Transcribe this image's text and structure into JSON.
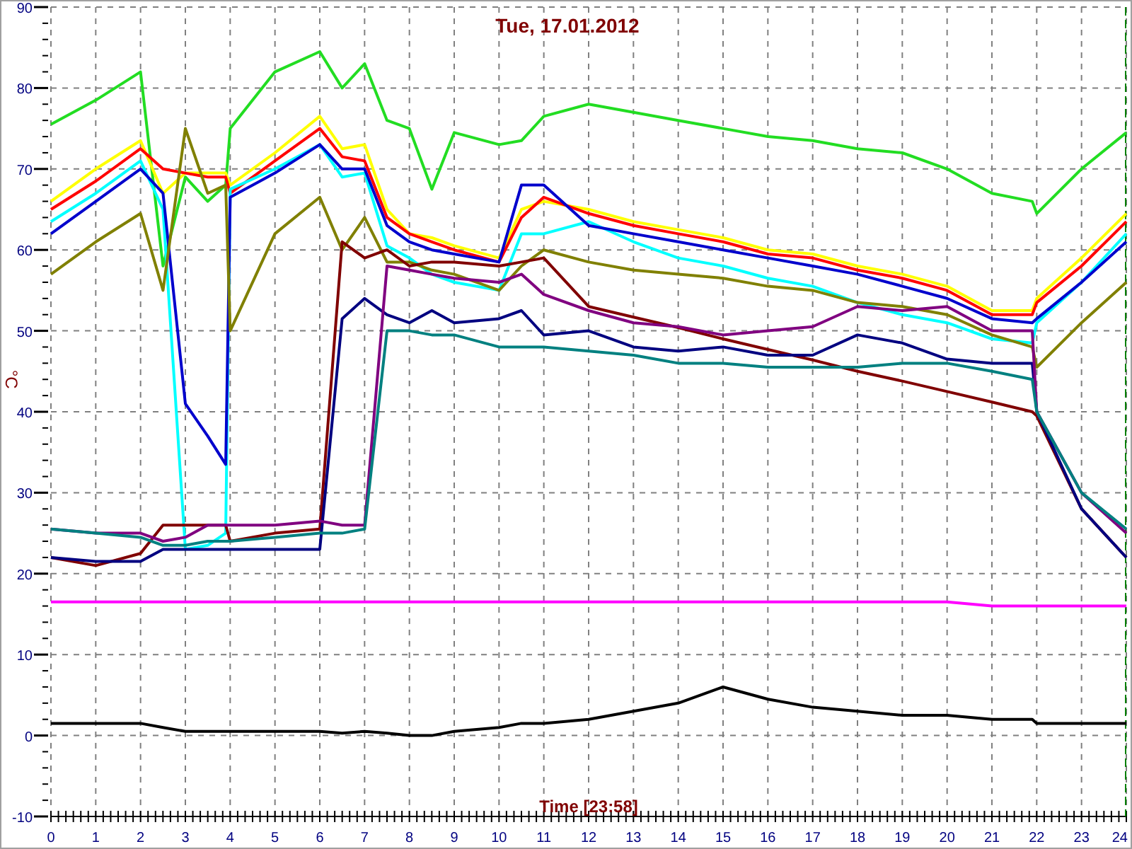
{
  "chart": {
    "chart_data": {
      "type": "line",
      "title": "Tue, 17.01.2012",
      "xlabel": "Time [23:58]",
      "ylabel": "°C",
      "x": [
        0,
        1,
        2,
        2.5,
        3,
        3.5,
        3.9,
        4,
        5,
        6,
        6.5,
        7,
        7.5,
        8,
        8.5,
        9,
        10,
        10.5,
        11,
        12,
        13,
        14,
        15,
        16,
        17,
        18,
        19,
        20,
        21,
        21.9,
        22,
        23,
        24
      ],
      "series": [
        {
          "color": "#22dd22",
          "values": [
            75.5,
            78.5,
            82,
            58,
            69,
            66,
            68,
            75,
            82,
            84.5,
            80,
            83,
            76,
            75,
            67.5,
            74.5,
            73,
            73.5,
            76.5,
            78,
            77,
            76,
            75,
            74,
            73.5,
            72.5,
            72,
            70,
            67,
            66,
            64.5,
            70,
            74.5
          ]
        },
        {
          "color": "#ffff00",
          "values": [
            66,
            70,
            73.5,
            67,
            69.5,
            69.5,
            69.5,
            68,
            72,
            76.5,
            72.5,
            73,
            65,
            62,
            61.5,
            60.5,
            59,
            65,
            66,
            65,
            63.5,
            62.5,
            61.5,
            60,
            59.5,
            58,
            57,
            55.5,
            52.5,
            52.5,
            54,
            59,
            64.5
          ]
        },
        {
          "color": "#ff0000",
          "values": [
            65,
            68.5,
            72.5,
            70,
            69.5,
            69,
            69,
            67,
            71,
            75,
            71.5,
            71,
            64,
            62,
            61,
            60,
            58.5,
            64,
            66.5,
            64.5,
            63,
            62,
            61,
            59.5,
            59,
            57.5,
            56.5,
            55,
            52,
            52,
            53.5,
            58,
            63.5
          ]
        },
        {
          "color": "#00ffff",
          "values": [
            63.5,
            67,
            71,
            65,
            23,
            23.5,
            25,
            67.5,
            70,
            73,
            69,
            69.5,
            60.5,
            59,
            57,
            56,
            55,
            62,
            62,
            63.5,
            61,
            59,
            58,
            56.5,
            55.5,
            53.5,
            52,
            51,
            49,
            48.5,
            51,
            56,
            62
          ]
        },
        {
          "color": "#0000cc",
          "values": [
            62,
            66,
            70,
            67,
            41,
            37,
            33.5,
            66.5,
            69.5,
            73,
            70,
            70,
            63,
            61,
            60,
            59.5,
            58.5,
            68,
            68,
            63,
            62,
            61,
            60,
            59,
            58,
            57,
            55.5,
            54,
            51.5,
            51,
            51.5,
            56,
            61
          ]
        },
        {
          "color": "#808000",
          "values": [
            57,
            61,
            64.5,
            55,
            75,
            67,
            68,
            50,
            62,
            66.5,
            60,
            64,
            58.5,
            58.5,
            57.5,
            57,
            55,
            58,
            60,
            58.5,
            57.5,
            57,
            56.5,
            55.5,
            55,
            53.5,
            53,
            52,
            49.5,
            48,
            45.5,
            51,
            56
          ]
        },
        {
          "color": "#800000",
          "values": [
            22,
            21,
            22.5,
            26,
            26,
            26,
            26,
            24,
            25,
            25.5,
            61,
            59,
            60,
            58,
            58.5,
            58.5,
            58,
            58.5,
            59,
            53,
            51.7,
            50.4,
            49,
            47.7,
            46.4,
            45,
            43.8,
            42.5,
            41.2,
            40,
            39.5,
            28,
            22
          ]
        },
        {
          "color": "#000080",
          "values": [
            22,
            21.5,
            21.5,
            23,
            23,
            23,
            23,
            23,
            23,
            23,
            51.5,
            54,
            52,
            51,
            52.5,
            51,
            51.5,
            52.5,
            49.5,
            50,
            48,
            47.5,
            48,
            47,
            47,
            49.5,
            48.5,
            46.5,
            46,
            46,
            40,
            28,
            22
          ]
        },
        {
          "color": "#800080",
          "values": [
            25.5,
            25,
            25,
            24,
            24.5,
            26,
            26,
            26,
            26,
            26.5,
            26,
            26,
            58,
            57.5,
            57,
            56.5,
            56,
            57,
            54.5,
            52.5,
            51,
            50.5,
            49.5,
            50,
            50.5,
            53,
            52.5,
            53,
            50,
            50,
            40,
            30,
            25
          ]
        },
        {
          "color": "#008080",
          "values": [
            25.5,
            25,
            24.5,
            23.5,
            23.5,
            24,
            24,
            24,
            24.5,
            25,
            25,
            25.5,
            50,
            50,
            49.5,
            49.5,
            48,
            48,
            48,
            47.5,
            47,
            46,
            46,
            45.5,
            45.5,
            45.5,
            46,
            46,
            45,
            44,
            40,
            30,
            25.5
          ]
        },
        {
          "color": "#ff00ff",
          "values": [
            16.5,
            16.5,
            16.5,
            16.5,
            16.5,
            16.5,
            16.5,
            16.5,
            16.5,
            16.5,
            16.5,
            16.5,
            16.5,
            16.5,
            16.5,
            16.5,
            16.5,
            16.5,
            16.5,
            16.5,
            16.5,
            16.5,
            16.5,
            16.5,
            16.5,
            16.5,
            16.5,
            16.5,
            16,
            16,
            16,
            16,
            16
          ]
        },
        {
          "color": "#000000",
          "values": [
            1.5,
            1.5,
            1.5,
            1,
            0.5,
            0.5,
            0.5,
            0.5,
            0.5,
            0.5,
            0.3,
            0.5,
            0.3,
            0,
            0,
            0.5,
            1,
            1.5,
            1.5,
            2,
            3,
            4,
            6,
            4.5,
            3.5,
            3,
            2.5,
            2.5,
            2,
            2,
            1.5,
            1.5,
            1.5
          ]
        }
      ],
      "grid": true,
      "xlim": [
        0,
        24
      ],
      "ylim": [
        -10,
        90
      ],
      "xticks": [
        0,
        1,
        2,
        3,
        4,
        5,
        6,
        7,
        8,
        9,
        10,
        11,
        12,
        13,
        14,
        15,
        16,
        17,
        18,
        19,
        20,
        21,
        22,
        23,
        24
      ],
      "yticks": [
        -10,
        0,
        10,
        20,
        30,
        40,
        50,
        60,
        70,
        80,
        90
      ]
    }
  }
}
